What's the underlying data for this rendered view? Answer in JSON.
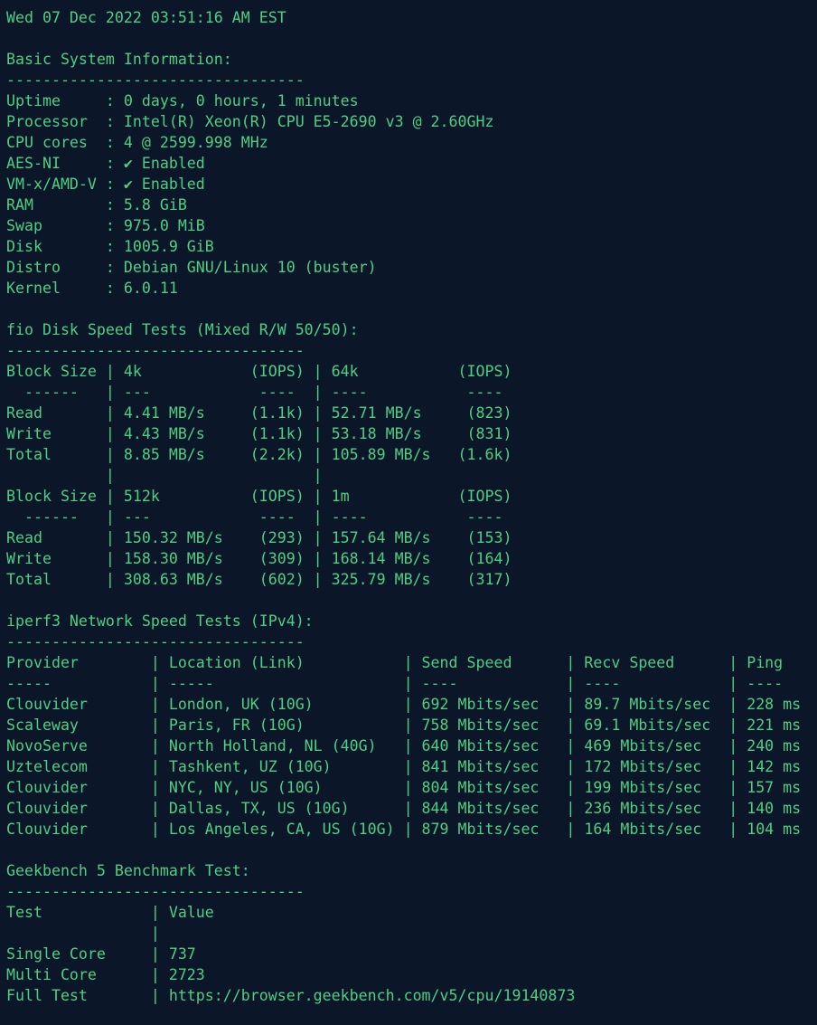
{
  "terminal": {
    "lines": [
      "Wed 07 Dec 2022 03:51:16 AM EST",
      "",
      "Basic System Information:",
      "---------------------------------",
      "Uptime     : 0 days, 0 hours, 1 minutes",
      "Processor  : Intel(R) Xeon(R) CPU E5-2690 v3 @ 2.60GHz",
      "CPU cores  : 4 @ 2599.998 MHz",
      "AES-NI     : ✔ Enabled",
      "VM-x/AMD-V : ✔ Enabled",
      "RAM        : 5.8 GiB",
      "Swap       : 975.0 MiB",
      "Disk       : 1005.9 GiB",
      "Distro     : Debian GNU/Linux 10 (buster)",
      "Kernel     : 6.0.11",
      "",
      "fio Disk Speed Tests (Mixed R/W 50/50):",
      "---------------------------------",
      "Block Size | 4k            (IOPS) | 64k           (IOPS)",
      "  ------   | ---            ----  | ----           ----",
      "Read       | 4.41 MB/s     (1.1k) | 52.71 MB/s     (823)",
      "Write      | 4.43 MB/s     (1.1k) | 53.18 MB/s     (831)",
      "Total      | 8.85 MB/s     (2.2k) | 105.89 MB/s   (1.6k)",
      "           |                      |",
      "Block Size | 512k          (IOPS) | 1m            (IOPS)",
      "  ------   | ---            ----  | ----           ----",
      "Read       | 150.32 MB/s    (293) | 157.64 MB/s    (153)",
      "Write      | 158.30 MB/s    (309) | 168.14 MB/s    (164)",
      "Total      | 308.63 MB/s    (602) | 325.79 MB/s    (317)",
      "",
      "iperf3 Network Speed Tests (IPv4):",
      "---------------------------------",
      "Provider        | Location (Link)           | Send Speed      | Recv Speed      | Ping",
      "-----           | -----                     | ----            | ----            | ----",
      "Clouvider       | London, UK (10G)          | 692 Mbits/sec   | 89.7 Mbits/sec  | 228 ms",
      "Scaleway        | Paris, FR (10G)           | 758 Mbits/sec   | 69.1 Mbits/sec  | 221 ms",
      "NovoServe       | North Holland, NL (40G)   | 640 Mbits/sec   | 469 Mbits/sec   | 240 ms",
      "Uztelecom       | Tashkent, UZ (10G)        | 841 Mbits/sec   | 172 Mbits/sec   | 142 ms",
      "Clouvider       | NYC, NY, US (10G)         | 804 Mbits/sec   | 199 Mbits/sec   | 157 ms",
      "Clouvider       | Dallas, TX, US (10G)      | 844 Mbits/sec   | 236 Mbits/sec   | 140 ms",
      "Clouvider       | Los Angeles, CA, US (10G) | 879 Mbits/sec   | 164 Mbits/sec   | 104 ms",
      "",
      "Geekbench 5 Benchmark Test:",
      "---------------------------------",
      "Test            | Value",
      "                |",
      "Single Core     | 737",
      "Multi Core      | 2723",
      "Full Test       | https://browser.geekbench.com/v5/cpu/19140873"
    ]
  },
  "colors": {
    "background": "#0b1628",
    "text": "#4fcf83"
  }
}
